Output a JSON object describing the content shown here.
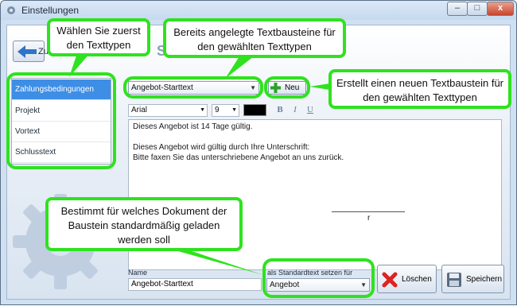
{
  "window": {
    "title": "Einstellungen",
    "buttons": {
      "minimize": "–",
      "maximize": "□",
      "close": "x"
    }
  },
  "nav": {
    "back_label": "Zu",
    "header_partial": "S"
  },
  "categories": [
    {
      "label": "Zahlungsbedingungen",
      "selected": true
    },
    {
      "label": "Projekt",
      "selected": false
    },
    {
      "label": "Vortext",
      "selected": false
    },
    {
      "label": "Schlusstext",
      "selected": false
    }
  ],
  "template_combo": {
    "value": "Angebot-Starttext"
  },
  "new_button": {
    "label": "Neu"
  },
  "format_toolbar": {
    "font": "Arial",
    "size": "9",
    "text_color": "#000000",
    "bold": "B",
    "italic": "I",
    "underline": "U"
  },
  "editor": {
    "lines": [
      "Dieses Angebot ist 14 Tage gültig.",
      "",
      "Dieses Angebot wird gültig durch Ihre Unterschrift:",
      "Bitte faxen Sie das unterschriebene Angebot an uns zurück."
    ],
    "signature_fragment": "r"
  },
  "footer": {
    "name_label": "Name",
    "name_value": "Angebot-Starttext",
    "default_label": "als Standardtext setzen für",
    "default_value": "Angebot",
    "delete_label": "Löschen",
    "save_label": "Speichern"
  },
  "callouts": {
    "select_type": [
      "Wählen Sie zuerst",
      "den Texttypen"
    ],
    "existing_blocks": [
      "Bereits angelegte Textbausteine für",
      "den gewählten Texttypen"
    ],
    "create_block": [
      "Erstellt einen neuen Textbaustein für",
      "den gewählten Texttypen"
    ],
    "default_doc": [
      "Bestimmt für welches Dokument der",
      "Baustein standardmäßig geladen",
      "werden soll"
    ]
  },
  "colors": {
    "highlight": "#2fe21f",
    "selection": "#3e8ee6",
    "window_bg": "#cfe0f3"
  }
}
